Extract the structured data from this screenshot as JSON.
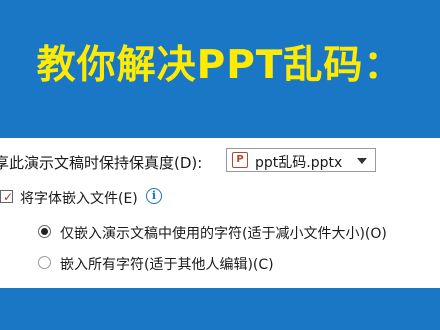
{
  "banner": {
    "title": "教你解决PPT乱码："
  },
  "dialog": {
    "heading_label": "享此演示文稿时保持保真度(D):",
    "file_select": {
      "value": "ppt乱码.pptx",
      "icon": "powerpoint-file-icon"
    },
    "embed_fonts": {
      "label": "将字体嵌入文件(E)",
      "checked": true,
      "info_icon": "info-icon",
      "info_glyph": "i"
    },
    "radio_options": [
      {
        "label": "仅嵌入演示文稿中使用的字符(适于减小文件大小)(O)",
        "selected": true
      },
      {
        "label": "嵌入所有字符(适于其他人编辑)(C)",
        "selected": false
      }
    ]
  },
  "colors": {
    "background": "#1a77c5",
    "title": "#ffeb00",
    "panel": "#ffffff"
  }
}
